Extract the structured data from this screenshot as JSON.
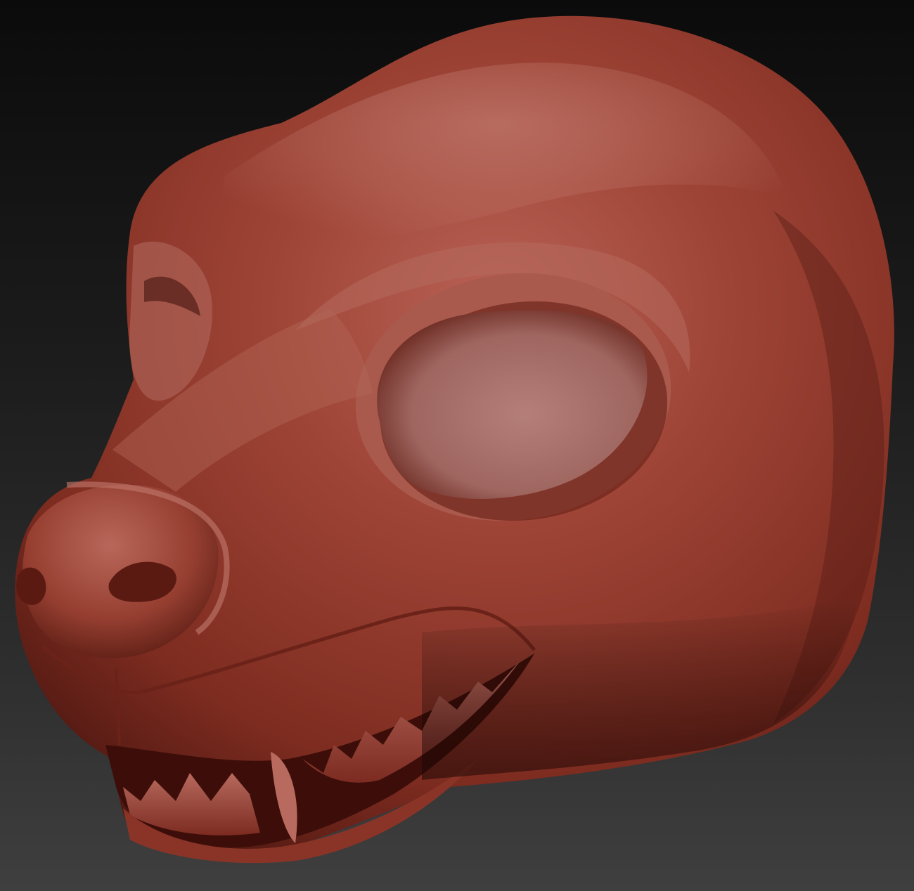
{
  "scene": {
    "subject": "sculpted-animal-head-model",
    "material_colors": {
      "base": "#9a3c2e",
      "highlight": "#c77a6e",
      "shadow": "#4a1610",
      "eye_socket": "#a7706b",
      "background_top": "#0b0b0b",
      "background_bottom": "#3f3f3f"
    }
  }
}
